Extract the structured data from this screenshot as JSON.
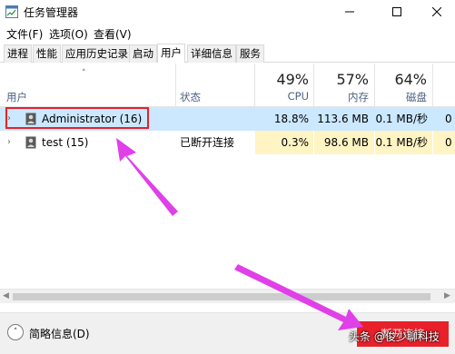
{
  "window": {
    "title": "任务管理器"
  },
  "menu": [
    "文件(F)",
    "选项(O)",
    "查看(V)"
  ],
  "tabs": [
    "进程",
    "性能",
    "应用历史记录",
    "启动",
    "用户",
    "详细信息",
    "服务"
  ],
  "active_tab": "用户",
  "columns": {
    "user": "用户",
    "status": "状态",
    "cpu": {
      "label": "CPU",
      "total": "49%"
    },
    "memory": {
      "label": "内存",
      "total": "57%"
    },
    "disk": {
      "label": "磁盘",
      "total": "64%"
    }
  },
  "rows": [
    {
      "name": "Administrator (16)",
      "status": "",
      "cpu": "18.8%",
      "memory": "113.6 MB",
      "disk": "0.1 MB/秒",
      "extra": "0"
    },
    {
      "name": "test (15)",
      "status": "已断开连接",
      "cpu": "0.3%",
      "memory": "98.6 MB",
      "disk": "0.1 MB/秒",
      "extra": "0"
    }
  ],
  "footer": {
    "collapse_label": "简略信息(D)",
    "action_button": "断开连接"
  },
  "watermark": "头条 @俊少聊科技",
  "colors": {
    "highlight": "#e8202a",
    "arrow": "#e040e8",
    "selected_row": "#cce8ff",
    "heat": "#fff4c4"
  }
}
